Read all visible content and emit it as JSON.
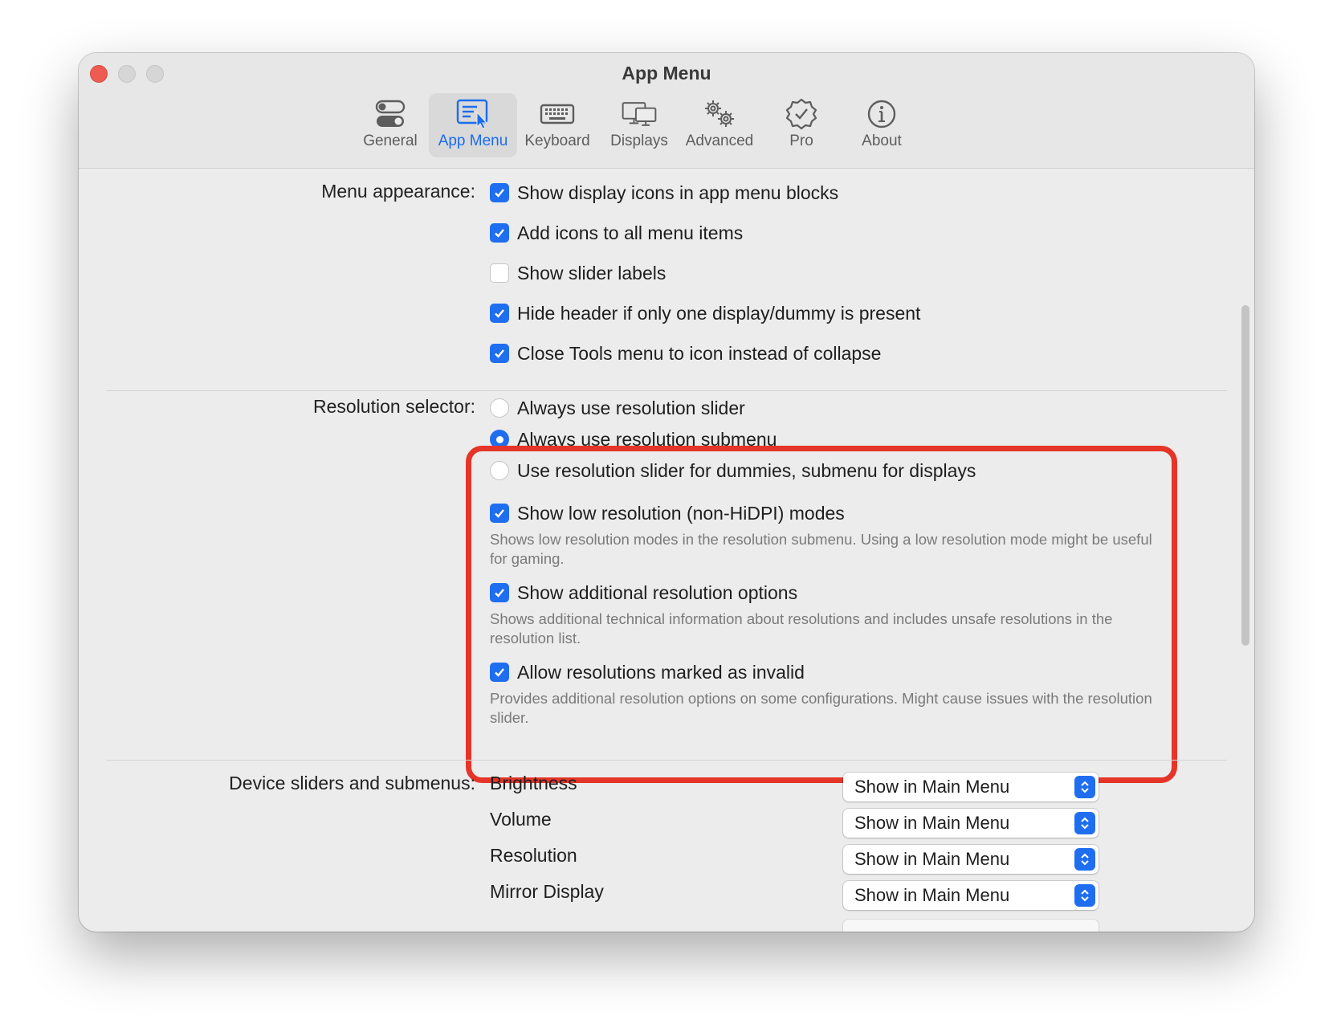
{
  "window": {
    "title": "App Menu"
  },
  "tabs": [
    {
      "label": "General",
      "icon": "toggle-icon"
    },
    {
      "label": "App Menu",
      "icon": "app-menu-icon",
      "active": true
    },
    {
      "label": "Keyboard",
      "icon": "keyboard-icon"
    },
    {
      "label": "Displays",
      "icon": "displays-icon"
    },
    {
      "label": "Advanced",
      "icon": "gears-icon"
    },
    {
      "label": "Pro",
      "icon": "verified-badge-icon"
    },
    {
      "label": "About",
      "icon": "info-icon"
    }
  ],
  "menu_appearance": {
    "label": "Menu appearance:",
    "options": [
      {
        "label": "Show display icons in app menu blocks",
        "checked": true
      },
      {
        "label": "Add icons to all menu items",
        "checked": true
      },
      {
        "label": "Show slider labels",
        "checked": false
      },
      {
        "label": "Hide header if only one display/dummy is present",
        "checked": true
      },
      {
        "label": "Close Tools menu to icon instead of collapse",
        "checked": true
      }
    ]
  },
  "resolution_selector": {
    "label": "Resolution selector:",
    "radios": [
      {
        "label": "Always use resolution slider",
        "selected": false
      },
      {
        "label": "Always use resolution submenu",
        "selected": true
      },
      {
        "label": "Use resolution slider for dummies, submenu for displays",
        "selected": false
      }
    ],
    "options": [
      {
        "label": "Show low resolution (non-HiDPI) modes",
        "checked": true,
        "description": "Shows low resolution modes in the resolution submenu. Using a low resolution mode might be useful for gaming."
      },
      {
        "label": "Show additional resolution options",
        "checked": true,
        "description": "Shows additional technical information about resolutions and includes unsafe resolutions in the resolution list."
      },
      {
        "label": "Allow resolutions marked as invalid",
        "checked": true,
        "description": "Provides additional resolution options on some configurations. Might cause issues with the resolution slider."
      }
    ]
  },
  "device_sliders": {
    "label": "Device sliders and submenus:",
    "items": [
      {
        "label": "Brightness",
        "value": "Show in Main Menu"
      },
      {
        "label": "Volume",
        "value": "Show in Main Menu"
      },
      {
        "label": "Resolution",
        "value": "Show in Main Menu"
      },
      {
        "label": "Mirror Display",
        "value": "Show in Main Menu"
      }
    ]
  },
  "colors": {
    "accent": "#1f6ef0",
    "highlight": "#e53528"
  }
}
